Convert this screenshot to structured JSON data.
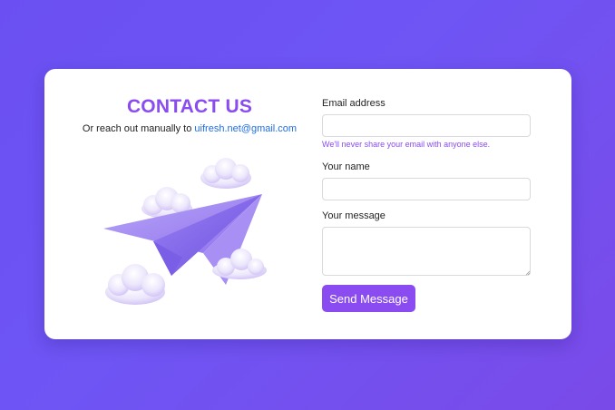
{
  "contact": {
    "title": "CONTACT US",
    "subline_prefix": "Or reach out manually to",
    "email_link": "uifresh.net@gmail.com"
  },
  "form": {
    "email_label": "Email address",
    "email_value": "",
    "email_help": "We'll never share your email with anyone else.",
    "name_label": "Your name",
    "name_value": "",
    "message_label": "Your message",
    "message_value": "",
    "submit_label": "Send Message"
  },
  "colors": {
    "accent": "#8a4cf0",
    "link": "#1e6ee8",
    "background_start": "#6b4ff2",
    "background_end": "#7a4ae8"
  },
  "illustration": {
    "icon": "paper-plane-clouds-icon"
  }
}
